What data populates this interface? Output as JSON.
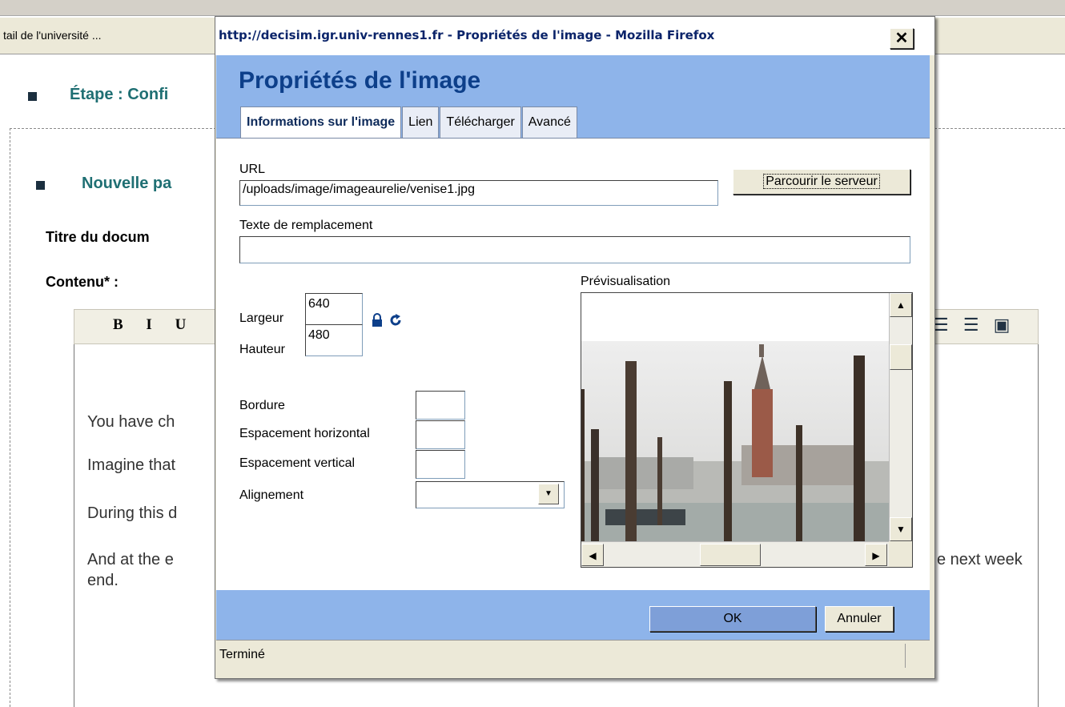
{
  "background_page": {
    "tab_label": "tail de l'université ...",
    "step_heading": "Étape : Confi",
    "new_page_heading": "Nouvelle pa",
    "title_label": "Titre du docum",
    "content_label": "Contenu* :",
    "toolbar_left": "B I U",
    "toolbar_right": "☰ ☰ ▣",
    "lines": [
      "You have ch",
      "Imagine that",
      "During this d",
      "And at the e",
      "end."
    ],
    "line_tail": "e next week"
  },
  "dialog": {
    "window_title": "http://decisim.igr.univ-rennes1.fr - Propriétés de l'image - Mozilla Firefox",
    "close_glyph": "✕",
    "heading": "Propriétés de l'image",
    "tabs": [
      {
        "label": "Informations sur l'image",
        "active": true
      },
      {
        "label": "Lien",
        "active": false
      },
      {
        "label": "Télécharger",
        "active": false
      },
      {
        "label": "Avancé",
        "active": false
      }
    ],
    "url_label": "URL",
    "url_value": "/uploads/image/imageaurelie/venise1.jpg",
    "browse_button": "Parcourir le serveur",
    "alt_label": "Texte de remplacement",
    "alt_value": "",
    "width_label": "Largeur",
    "width_value": "640",
    "height_label": "Hauteur",
    "height_value": "480",
    "lock_icon": "lock-icon",
    "reset_icon": "refresh-icon",
    "border_label": "Bordure",
    "border_value": "",
    "hspace_label": "Espacement horizontal",
    "hspace_value": "",
    "vspace_label": "Espacement vertical",
    "vspace_value": "",
    "align_label": "Alignement",
    "align_value": "",
    "preview_label": "Prévisualisation",
    "ok_button": "OK",
    "cancel_button": "Annuler",
    "status_text": "Terminé"
  }
}
